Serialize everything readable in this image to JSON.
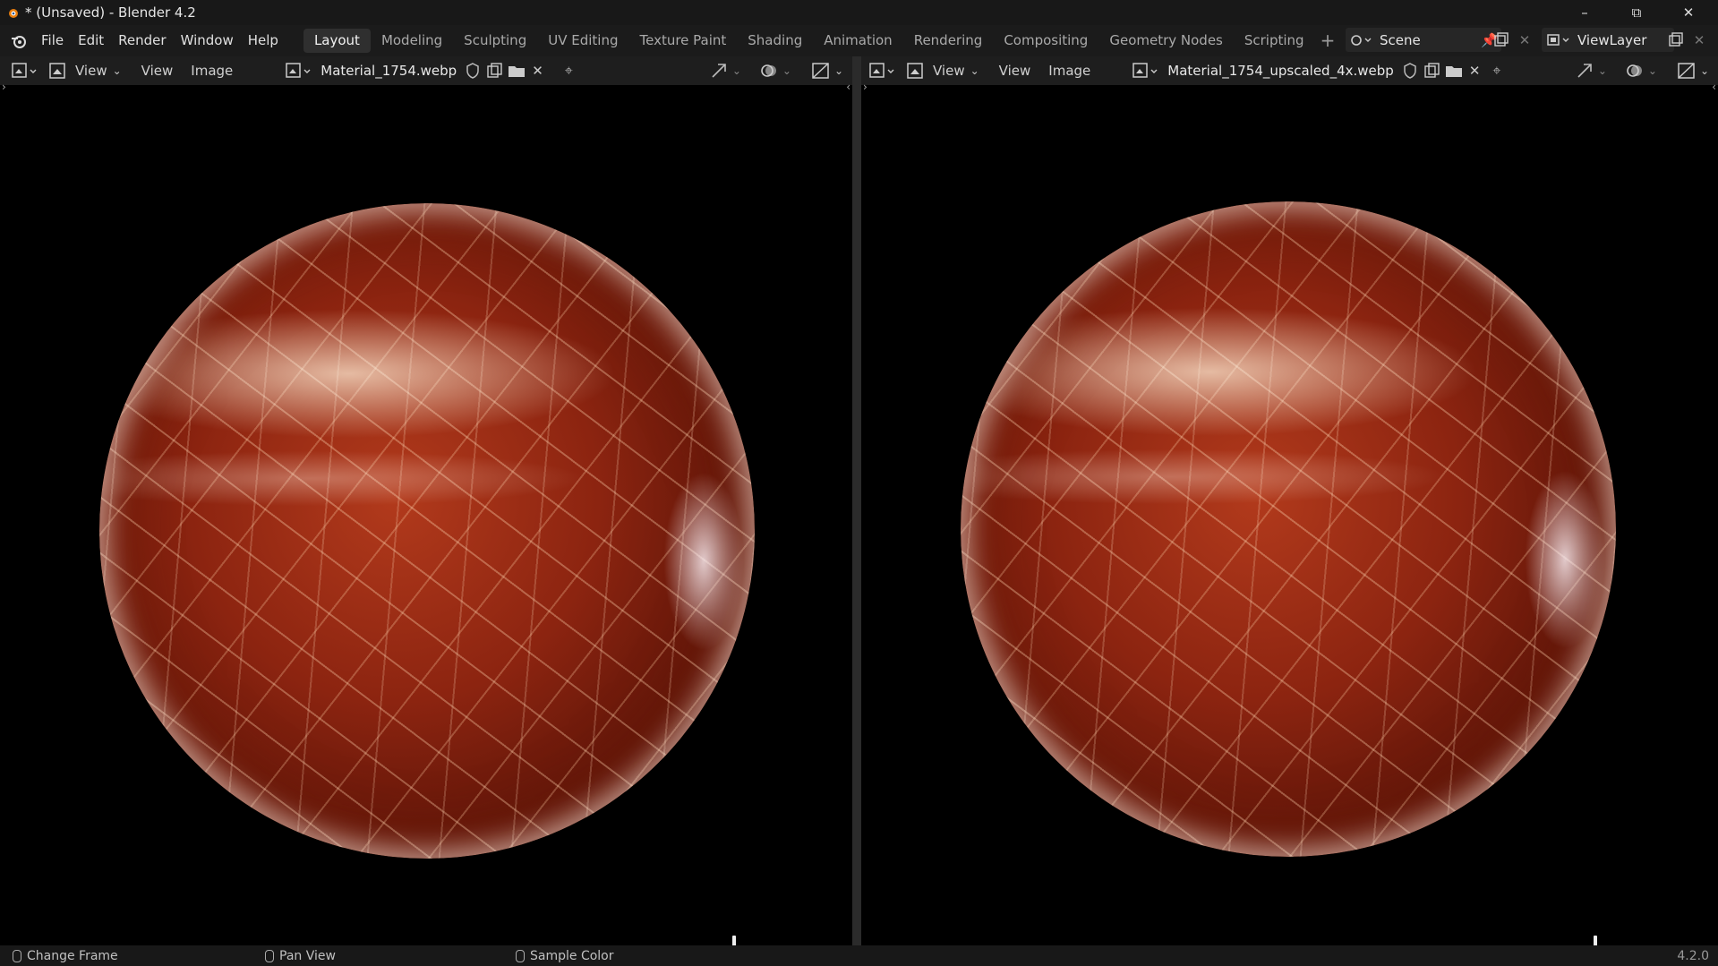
{
  "window": {
    "title": "* (Unsaved) - Blender 4.2",
    "minimize": "–",
    "maximize": "⧉",
    "close": "✕"
  },
  "menu": [
    "File",
    "Edit",
    "Render",
    "Window",
    "Help"
  ],
  "workspaces": [
    "Layout",
    "Modeling",
    "Sculpting",
    "UV Editing",
    "Texture Paint",
    "Shading",
    "Animation",
    "Rendering",
    "Compositing",
    "Geometry Nodes",
    "Scripting"
  ],
  "active_workspace": "Layout",
  "add_workspace": "+",
  "scene": {
    "label": "Scene"
  },
  "view_layer": {
    "label": "ViewLayer"
  },
  "editors": [
    {
      "view_dropdown": "View",
      "view_menu": "View",
      "image_menu": "Image",
      "image_name": "Material_1754.webp"
    },
    {
      "view_dropdown": "View",
      "view_menu": "View",
      "image_menu": "Image",
      "image_name": "Material_1754_upscaled_4x.webp"
    }
  ],
  "status": {
    "left": "Change Frame",
    "middle": "Pan View",
    "right": "Sample Color",
    "version": "4.2.0"
  },
  "colors": {
    "accent": "#2f2f2f",
    "background": "#000000",
    "marble": "#8c2410"
  }
}
